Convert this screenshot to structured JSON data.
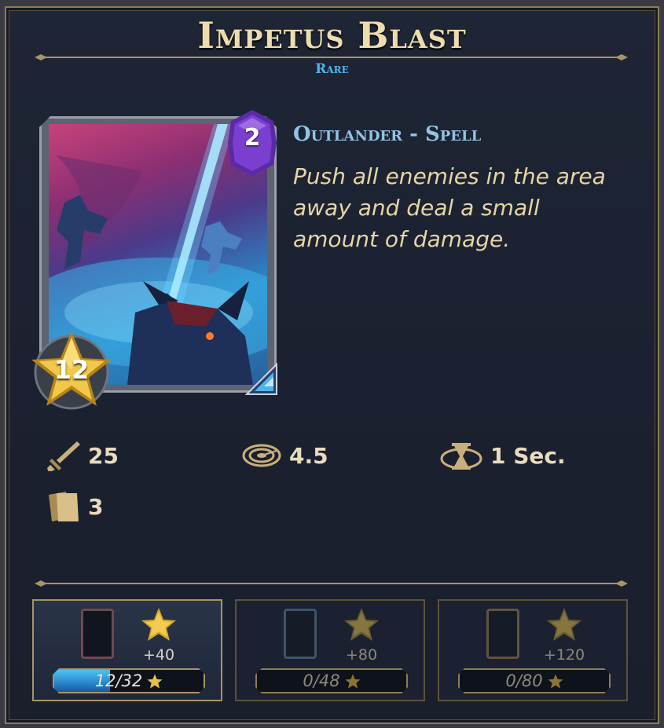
{
  "card": {
    "name": "Impetus Blast",
    "rarity": "Rare",
    "mana_cost": "2",
    "level": "12",
    "type_line": "Outlander - Spell",
    "description": "Push all enemies in the area away and deal a small amount of damage."
  },
  "stats": [
    {
      "icon": "sword-icon",
      "value": "25"
    },
    {
      "icon": "radius-icon",
      "value": "4.5"
    },
    {
      "icon": "hourglass-icon",
      "value": "1 Sec."
    },
    {
      "icon": "cards-icon",
      "value": "3"
    }
  ],
  "tiers": [
    {
      "bonus": "+40",
      "progress_text": "12/32",
      "progress_fraction": 0.375
    },
    {
      "bonus": "+80",
      "progress_text": "0/48",
      "progress_fraction": 0
    },
    {
      "bonus": "+120",
      "progress_text": "0/80",
      "progress_fraction": 0
    }
  ],
  "colors": {
    "title": "#ecdcae",
    "rarity": "#4fb4ea",
    "type_line": "#93c4e4",
    "description": "#e6d6a6",
    "mana_gem": "#7b3fd0",
    "gold": "#d4a82a",
    "progress": "#2a8bd0"
  }
}
